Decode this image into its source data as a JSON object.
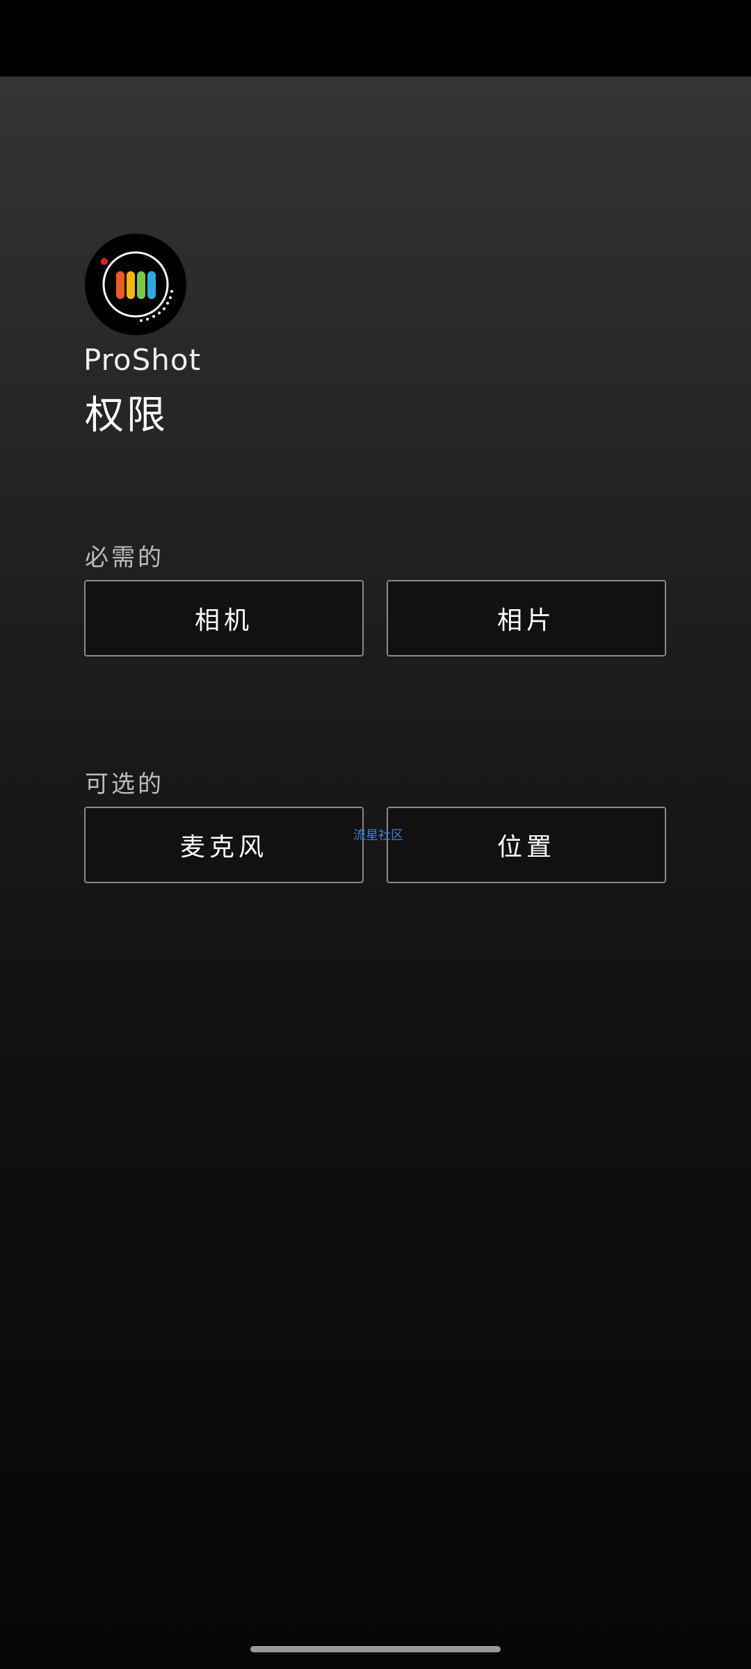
{
  "app": {
    "name": "ProShot",
    "page_title": "权限"
  },
  "sections": {
    "required": {
      "label": "必需的",
      "buttons": [
        "相机",
        "相片"
      ]
    },
    "optional": {
      "label": "可选的",
      "buttons": [
        "麦克风",
        "位置"
      ]
    }
  },
  "watermark": "流星社区",
  "icons": {
    "logo": "proshot-logo-icon"
  },
  "colors": {
    "background_top": "#343434",
    "background_bottom": "#060606",
    "button_border": "#8a8a8a",
    "logo_bars": [
      "#f15a24",
      "#f7b500",
      "#7ac943",
      "#29abe2"
    ],
    "logo_dot": "#e02020"
  }
}
